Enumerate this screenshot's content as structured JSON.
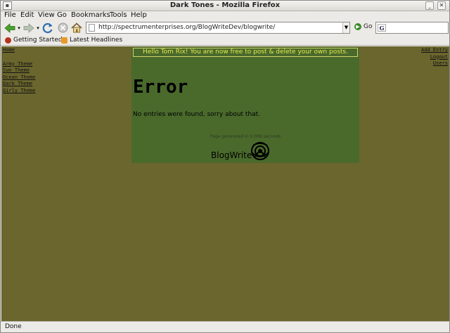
{
  "window": {
    "title": "Dark Tones - Mozilla Firefox"
  },
  "menu": [
    "File",
    "Edit",
    "View",
    "Go",
    "Bookmarks",
    "Tools",
    "Help"
  ],
  "toolbar": {
    "url": "http://spectrumenterprises.org/BlogWriteDev/blogwrite/",
    "go_label": "Go"
  },
  "bookmarks": [
    "Getting Started",
    "Latest Headlines"
  ],
  "page": {
    "left_links": {
      "home": "Home",
      "themes": [
        "Army Theme",
        "Sun Theme",
        "Ocean Theme",
        "Dark Theme",
        "Girly Theme"
      ]
    },
    "right_links": [
      "Add Entry",
      "Logout",
      "Users"
    ],
    "welcome": "Hello Tom Rix! You are now free to post & delete your own posts.",
    "error_title": "Error",
    "error_message": "No entries were found, sorry about that.",
    "generated": "Page generated in 0.008 seconds",
    "brand": "BlogWrite"
  },
  "status": "Done",
  "colors": {
    "page_bg": "#6b662e",
    "panel_bg": "#4a6a2c",
    "welcome_text": "#e4e84e"
  },
  "icons": [
    "back-arrow-icon",
    "forward-arrow-icon",
    "reload-icon",
    "stop-icon",
    "home-icon",
    "go-icon",
    "google-search-icon",
    "firefox-bookmark-icon",
    "rss-feed-icon",
    "blogwrite-flower-logo"
  ]
}
